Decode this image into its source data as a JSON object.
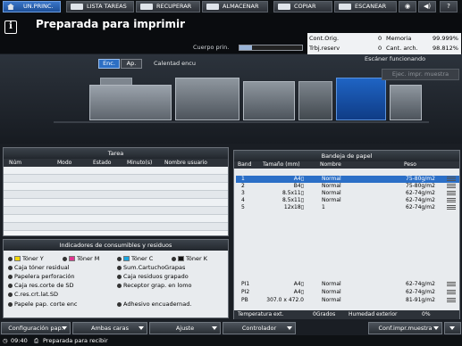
{
  "tabs": [
    "UN.PRINC.",
    "LISTA TAREAS",
    "RECUPERAR",
    "ALMACENAR",
    "COPIAR",
    "ESCANEAR"
  ],
  "top_icons": [
    "globe-icon",
    "speaker-icon",
    "help-icon"
  ],
  "help_label": "?",
  "header": {
    "title": "Preparada para imprimir",
    "cuerpo_label": "Cuerpo prin.",
    "cuerpo_level": 0.2
  },
  "counters": {
    "cont_orig_label": "Cont.Orig.",
    "cont_orig_value": "0",
    "memoria_label": "Memoria",
    "memoria_value": "99.999%",
    "trbj_label": "Trbj.reserv",
    "trbj_value": "0",
    "cant_label": "Cant. arch.",
    "cant_value": "98.812%"
  },
  "machine": {
    "enc_label": "Enc.",
    "ap_label": "Ap.",
    "calentad": "Calentad encu",
    "scanner": "Escáner funcionando",
    "ejec": "Ejec. impr. muestra"
  },
  "tarea": {
    "title": "Tarea",
    "columns": [
      "Núm",
      "Modo",
      "Estado",
      "Minuto(s)",
      "Nombre usuario"
    ]
  },
  "consumables": {
    "title": "Indicadores de consumibles y residuos",
    "items": [
      "Tóner Y",
      "Tóner M",
      "Tóner C",
      "Tóner K",
      "Caja tóner residual",
      "Sum.CartuchoGrapas",
      "Papelera perforación",
      "Caja residuos grapado",
      "Caja res.corte de SD",
      "Receptor grap. en lomo",
      "C.res.crt.lat.SD",
      "Papele pap. corte enc",
      "Adhesivo encuadernad."
    ]
  },
  "trays": {
    "title": "Bandeja de papel",
    "columns": [
      "Band",
      "Tamaño (mm)",
      "Nombre",
      "Peso"
    ],
    "rows": [
      {
        "band": "1",
        "size": "A4▯",
        "name": "Normal",
        "weight": "75-80g/m2"
      },
      {
        "band": "2",
        "size": "B4▯",
        "name": "Normal",
        "weight": "75-80g/m2"
      },
      {
        "band": "3",
        "size": "8.5x11▯",
        "name": "Normal",
        "weight": "62-74g/m2"
      },
      {
        "band": "4",
        "size": "8.5x11▯",
        "name": "Normal",
        "weight": "62-74g/m2"
      },
      {
        "band": "5",
        "size": "12x18▯",
        "name": "1",
        "weight": "62-74g/m2"
      }
    ],
    "pi_rows": [
      {
        "band": "PI1",
        "size": "A4▯",
        "name": "Normal",
        "weight": "62-74g/m2"
      },
      {
        "band": "PI2",
        "size": "A4▯",
        "name": "Normal",
        "weight": "62-74g/m2"
      },
      {
        "band": "PB",
        "size": "307.0 x 472.0",
        "name": "Normal",
        "weight": "81-91g/m2"
      }
    ],
    "temp_label": "Temperatura ext.",
    "temp_value": "0Grados",
    "hum_label": "Humedad exterior",
    "hum_value": "0%"
  },
  "bottom": {
    "config": "Configuración pap.",
    "ambas": "Ambas caras",
    "ajuste": "Ajuste",
    "controlador": "Controlador",
    "conf": "Conf.impr.muestra"
  },
  "status": {
    "time": "09:40",
    "text": "Preparada para recibir"
  }
}
